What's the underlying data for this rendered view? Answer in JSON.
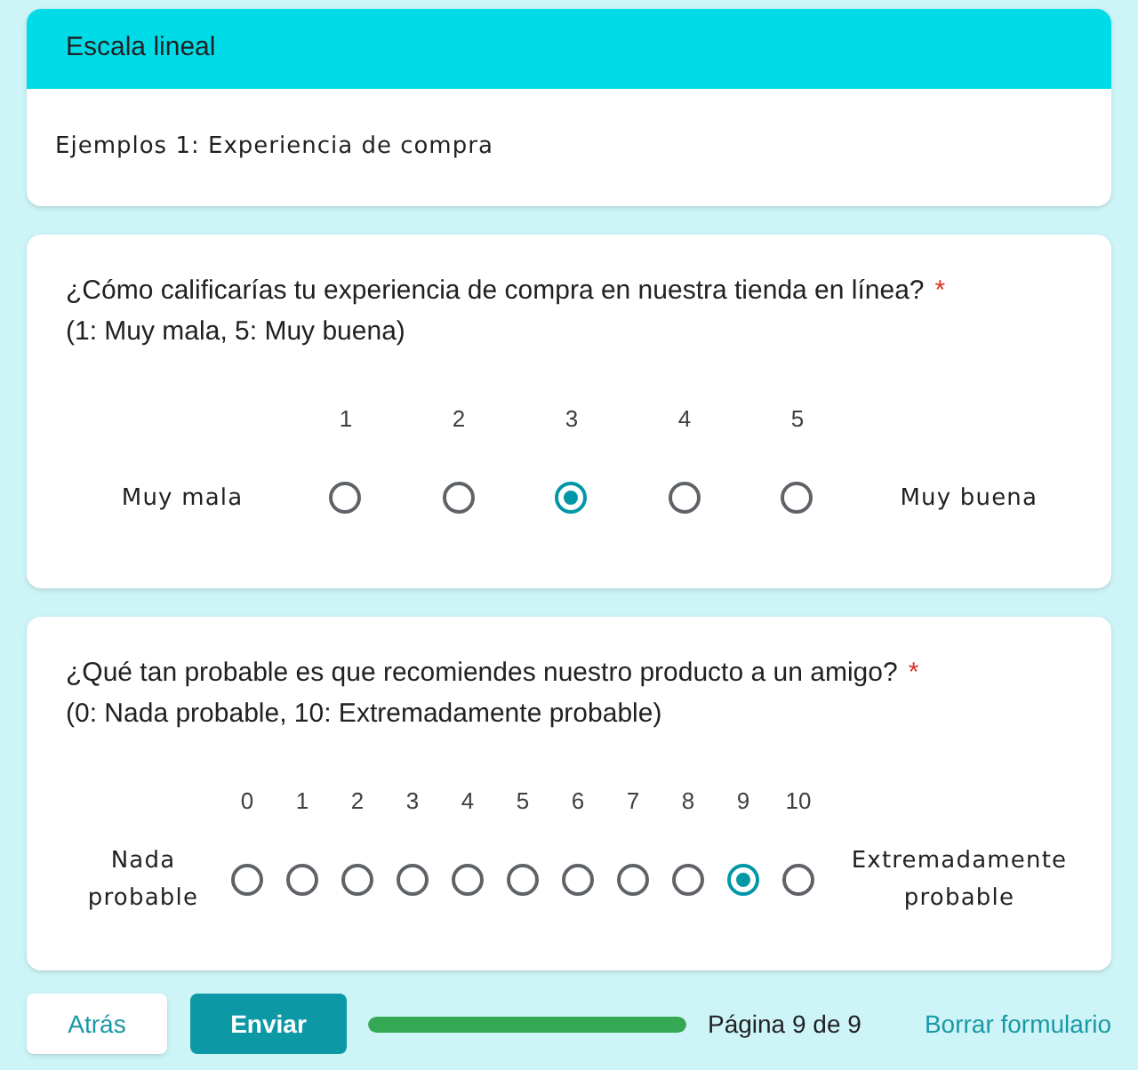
{
  "header": {
    "title": "Escala lineal",
    "description": "Ejemplos 1: Experiencia de compra"
  },
  "questions": [
    {
      "title": "¿Cómo calificarías tu experiencia de compra en nuestra tienda en línea?",
      "required_mark": "*",
      "hint": "(1: Muy mala, 5: Muy buena)",
      "min_label": "Muy mala",
      "max_label": "Muy buena",
      "options": [
        {
          "label": "1",
          "selected": false
        },
        {
          "label": "2",
          "selected": false
        },
        {
          "label": "3",
          "selected": true
        },
        {
          "label": "4",
          "selected": false
        },
        {
          "label": "5",
          "selected": false
        }
      ]
    },
    {
      "title": "¿Qué tan probable es que recomiendes nuestro producto a un amigo?",
      "required_mark": "*",
      "hint": "(0: Nada probable, 10: Extremadamente probable)",
      "min_label": "Nada probable",
      "max_label": "Extremadamente probable",
      "options": [
        {
          "label": "0",
          "selected": false
        },
        {
          "label": "1",
          "selected": false
        },
        {
          "label": "2",
          "selected": false
        },
        {
          "label": "3",
          "selected": false
        },
        {
          "label": "4",
          "selected": false
        },
        {
          "label": "5",
          "selected": false
        },
        {
          "label": "6",
          "selected": false
        },
        {
          "label": "7",
          "selected": false
        },
        {
          "label": "8",
          "selected": false
        },
        {
          "label": "9",
          "selected": true
        },
        {
          "label": "10",
          "selected": false
        }
      ]
    }
  ],
  "footer": {
    "back_button": "Atrás",
    "submit_button": "Enviar",
    "progress": {
      "level": 1
    },
    "page_label": "Página 9 de 9",
    "clear_link": "Borrar formulario"
  }
}
